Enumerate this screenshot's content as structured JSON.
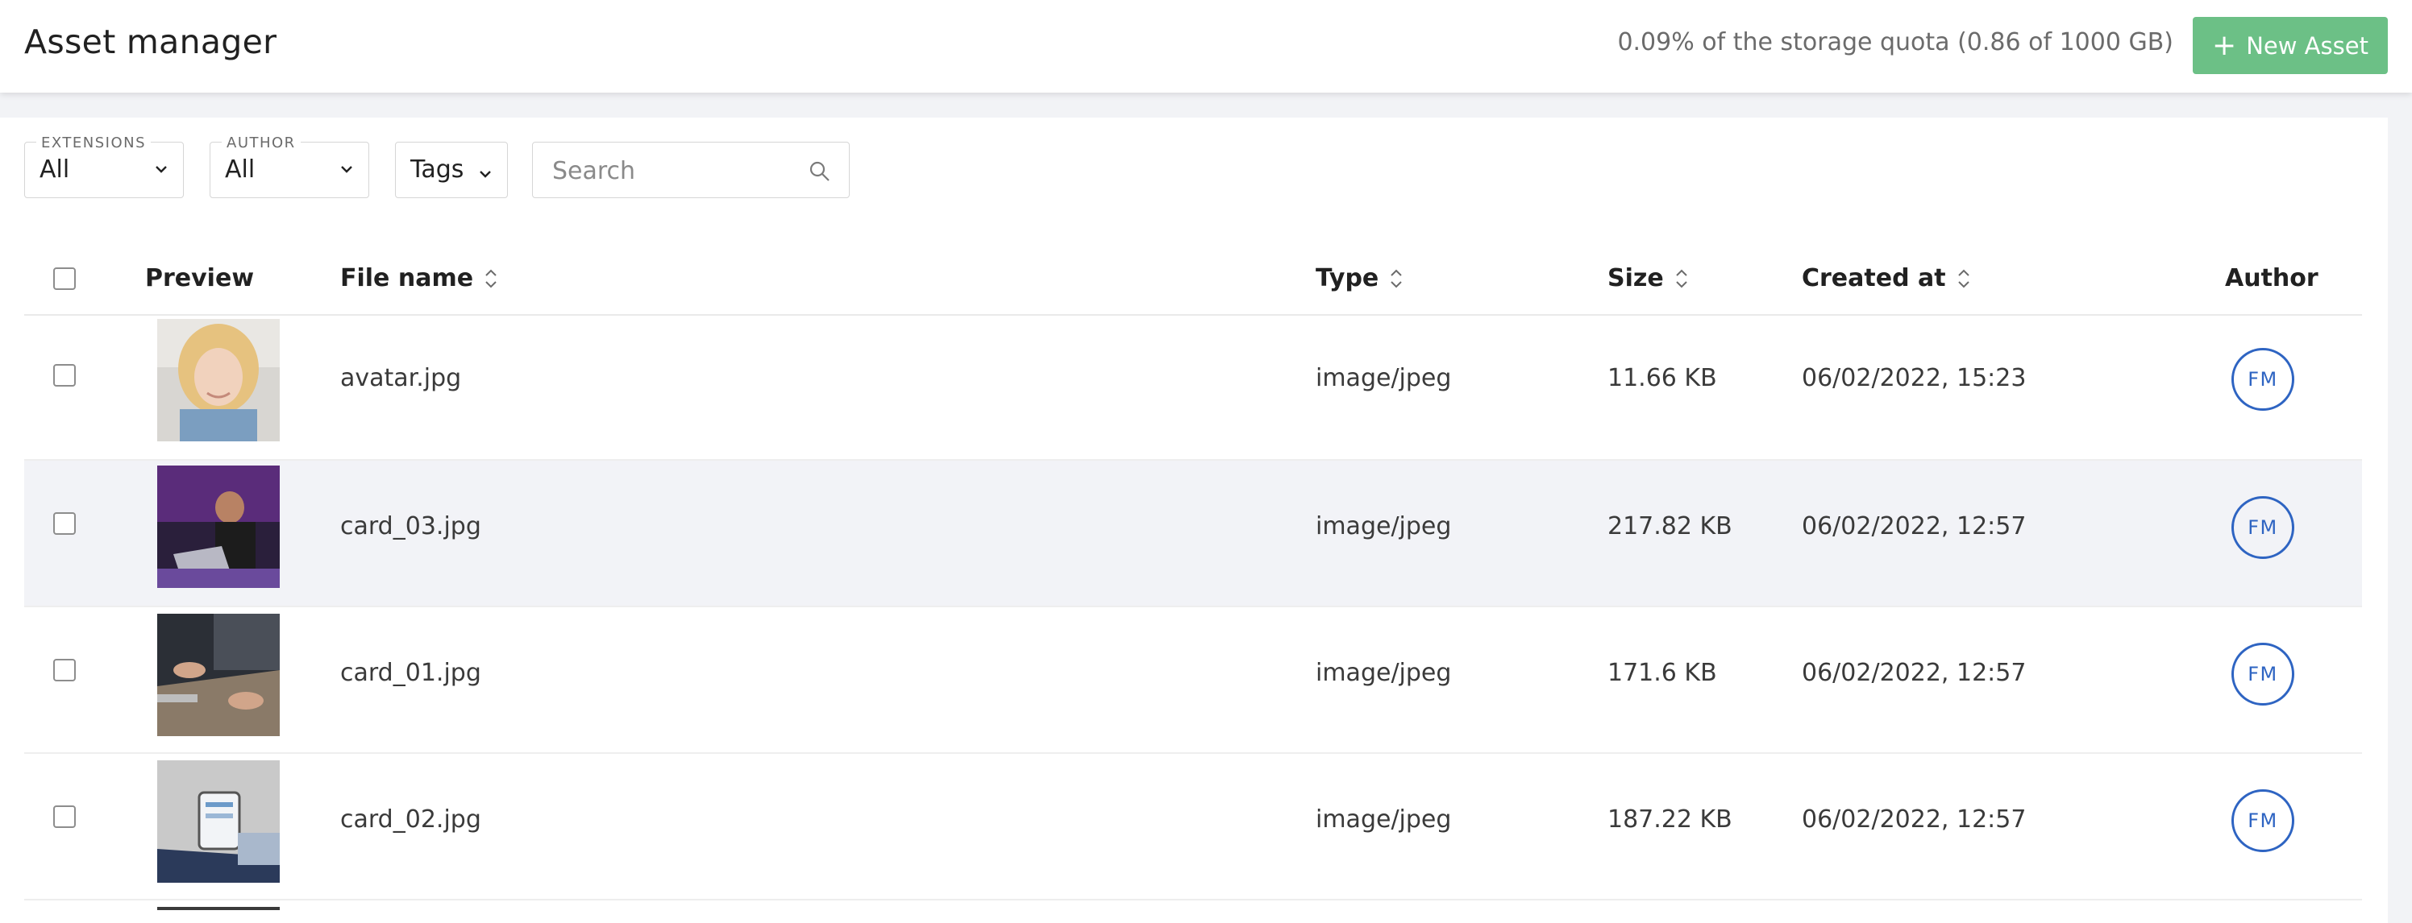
{
  "header": {
    "title": "Asset manager",
    "quota_text": "0.09% of the storage quota (0.86 of 1000 GB)",
    "new_asset_label": "New Asset",
    "accent_color": "#6cc086"
  },
  "filters": {
    "extensions": {
      "label": "EXTENSIONS",
      "value": "All"
    },
    "author": {
      "label": "AUTHOR",
      "value": "All"
    },
    "tags": {
      "value": "Tags"
    },
    "search": {
      "placeholder": "Search"
    }
  },
  "table": {
    "headers": {
      "preview": "Preview",
      "file_name": "File name",
      "type": "Type",
      "size": "Size",
      "created_at": "Created at",
      "author": "Author"
    },
    "rows": [
      {
        "file_name": "avatar.jpg",
        "type": "image/jpeg",
        "size": "11.66 KB",
        "created_at": "06/02/2022, 15:23",
        "author": "FM"
      },
      {
        "file_name": "card_03.jpg",
        "type": "image/jpeg",
        "size": "217.82 KB",
        "created_at": "06/02/2022, 12:57",
        "author": "FM"
      },
      {
        "file_name": "card_01.jpg",
        "type": "image/jpeg",
        "size": "171.6 KB",
        "created_at": "06/02/2022, 12:57",
        "author": "FM"
      },
      {
        "file_name": "card_02.jpg",
        "type": "image/jpeg",
        "size": "187.22 KB",
        "created_at": "06/02/2022, 12:57",
        "author": "FM"
      }
    ]
  }
}
